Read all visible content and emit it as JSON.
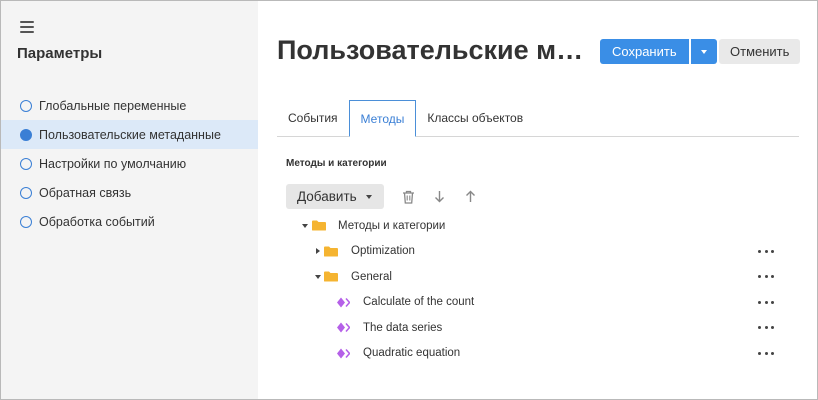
{
  "sidebar": {
    "title": "Параметры",
    "items": [
      {
        "label": "Глобальные переменные",
        "active": false
      },
      {
        "label": "Пользовательские метаданные",
        "active": true
      },
      {
        "label": "Настройки по умолчанию",
        "active": false
      },
      {
        "label": "Обратная связь",
        "active": false
      },
      {
        "label": "Обработка событий",
        "active": false
      }
    ]
  },
  "header": {
    "title": "Пользовательские метаданные",
    "save_label": "Сохранить",
    "cancel_label": "Отменить"
  },
  "tabs": [
    {
      "label": "События",
      "active": false
    },
    {
      "label": "Методы",
      "active": true
    },
    {
      "label": "Классы объектов",
      "active": false
    }
  ],
  "section": {
    "title": "Методы и категории",
    "add_label": "Добавить"
  },
  "tree": {
    "root": "Методы и категории",
    "optimization": "Optimization",
    "general": "General",
    "methods": [
      "Calculate of the count",
      "The data series",
      "Quadratic equation"
    ]
  },
  "colors": {
    "accent": "#3a8ee6",
    "folder": "#f5b431",
    "method_icon": "#b560e8",
    "active_nav_bg": "#dce9f8"
  },
  "icons": {
    "menu": "hamburger-icon",
    "delete": "trash-icon",
    "move_down": "arrow-down-icon",
    "move_up": "arrow-up-icon",
    "more": "more-horizontal-icon"
  }
}
